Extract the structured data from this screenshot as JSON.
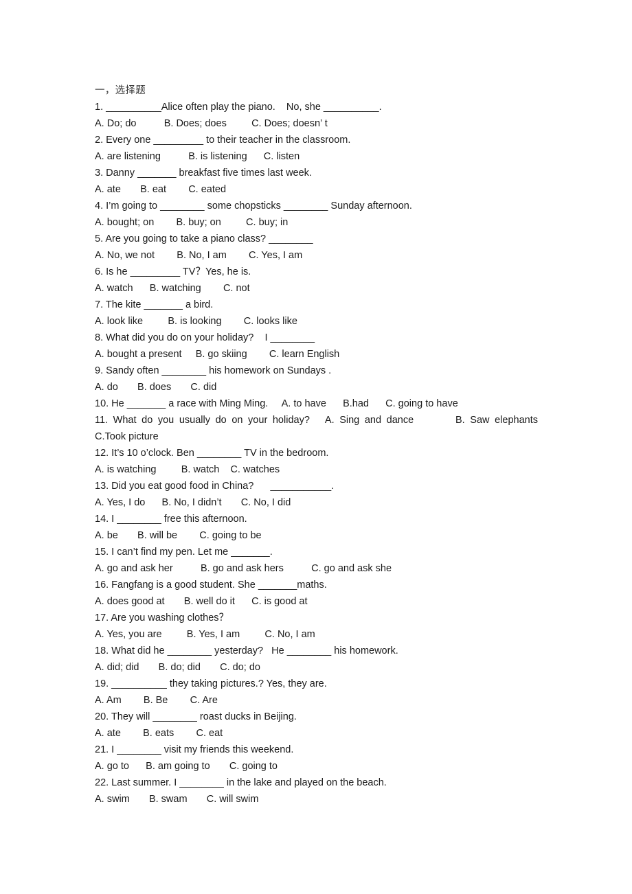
{
  "document": {
    "heading": "一，选择题",
    "lines": [
      {
        "id": "q1-stem",
        "kind": "stem",
        "text": "1. __________Alice often play the piano.    No, she __________."
      },
      {
        "id": "q1-options",
        "kind": "options",
        "text": "A. Do; do          B. Does; does         C. Does; doesn’ t"
      },
      {
        "id": "q2-stem",
        "kind": "stem",
        "text": "2. Every one _________ to their teacher in the classroom."
      },
      {
        "id": "q2-options",
        "kind": "options",
        "text": "A. are listening          B. is listening      C. listen"
      },
      {
        "id": "q3-stem",
        "kind": "stem",
        "text": "3. Danny _______ breakfast five times last week."
      },
      {
        "id": "q3-options",
        "kind": "options",
        "text": "A. ate       B. eat        C. eated"
      },
      {
        "id": "q4-stem",
        "kind": "stem",
        "text": "4. I’m going to ________ some chopsticks ________ Sunday afternoon."
      },
      {
        "id": "q4-options",
        "kind": "options",
        "text": "A. bought; on        B. buy; on         C. buy; in"
      },
      {
        "id": "q5-stem",
        "kind": "stem",
        "text": "5. Are you going to take a piano class? ________"
      },
      {
        "id": "q5-options",
        "kind": "options",
        "text": "A. No, we not        B. No, I am        C. Yes, I am"
      },
      {
        "id": "q6-stem",
        "kind": "stem",
        "text": "6. Is he _________ TV？Yes, he is."
      },
      {
        "id": "q6-options",
        "kind": "options",
        "text": "A. watch      B. watching        C. not"
      },
      {
        "id": "q7-stem",
        "kind": "stem",
        "text": "7. The kite _______ a bird."
      },
      {
        "id": "q7-options",
        "kind": "options",
        "text": "A. look like         B. is looking        C. looks like"
      },
      {
        "id": "q8-stem",
        "kind": "stem",
        "text": "8. What did you do on your holiday?    I ________"
      },
      {
        "id": "q8-options",
        "kind": "options",
        "text": "A. bought a present     B. go skiing        C. learn English"
      },
      {
        "id": "q9-stem",
        "kind": "stem",
        "text": "9. Sandy often ________ his homework on Sundays ."
      },
      {
        "id": "q9-options",
        "kind": "options",
        "text": "A. do       B. does       C. did"
      },
      {
        "id": "q10-line",
        "kind": "combined",
        "text": "10. He _______ a race with Ming Ming.     A. to have      B.had      C. going to have"
      },
      {
        "id": "q11-line1",
        "kind": "combined-justified",
        "text": "11. What do you usually do on your holiday?   A. Sing and dance        B. Saw elephants"
      },
      {
        "id": "q11-line2",
        "kind": "options",
        "text": "C.Took picture"
      },
      {
        "id": "q12-stem",
        "kind": "stem",
        "text": "12. It’s 10 o’clock. Ben ________ TV in the bedroom."
      },
      {
        "id": "q12-options",
        "kind": "options",
        "text": "A. is watching         B. watch    C. watches"
      },
      {
        "id": "q13-stem",
        "kind": "stem",
        "text": "13. Did you eat good food in China?      ___________."
      },
      {
        "id": "q13-options",
        "kind": "options",
        "text": "A. Yes, I do      B. No, I didn’t       C. No, I did"
      },
      {
        "id": "q14-stem",
        "kind": "stem",
        "text": "14. I ________ free this afternoon."
      },
      {
        "id": "q14-options",
        "kind": "options",
        "text": "A. be       B. will be        C. going to be"
      },
      {
        "id": "q15-stem",
        "kind": "stem",
        "text": "15. I can’t find my pen. Let me _______."
      },
      {
        "id": "q15-options",
        "kind": "options",
        "text": "A. go and ask her          B. go and ask hers          C. go and ask she"
      },
      {
        "id": "q16-stem",
        "kind": "stem",
        "text": "16. Fangfang is a good student. She _______maths."
      },
      {
        "id": "q16-options",
        "kind": "options",
        "text": "A. does good at       B. well do it      C. is good at"
      },
      {
        "id": "q17-stem",
        "kind": "stem",
        "text": "17. Are you washing clothes？"
      },
      {
        "id": "q17-options",
        "kind": "options",
        "text": "A. Yes, you are         B. Yes, I am         C. No, I am"
      },
      {
        "id": "q18-stem",
        "kind": "stem",
        "text": "18. What did he ________ yesterday?   He ________ his homework."
      },
      {
        "id": "q18-options",
        "kind": "options",
        "text": "A. did; did       B. do; did       C. do; do"
      },
      {
        "id": "q19-stem",
        "kind": "stem",
        "text": "19. __________ they taking pictures.? Yes, they are."
      },
      {
        "id": "q19-options",
        "kind": "options",
        "text": "A. Am        B. Be        C. Are"
      },
      {
        "id": "q20-stem",
        "kind": "stem",
        "text": "20. They will ________ roast ducks in Beijing."
      },
      {
        "id": "q20-options",
        "kind": "options",
        "text": "A. ate        B. eats        C. eat"
      },
      {
        "id": "q21-stem",
        "kind": "stem",
        "text": "21. I ________ visit my friends this weekend."
      },
      {
        "id": "q21-options",
        "kind": "options",
        "text": "A. go to      B. am going to       C. going to"
      },
      {
        "id": "q22-stem",
        "kind": "stem",
        "text": "22. Last summer. I ________ in the lake and played on the beach."
      },
      {
        "id": "q22-options",
        "kind": "options",
        "text": "A. swim       B. swam       C. will swim"
      }
    ]
  }
}
